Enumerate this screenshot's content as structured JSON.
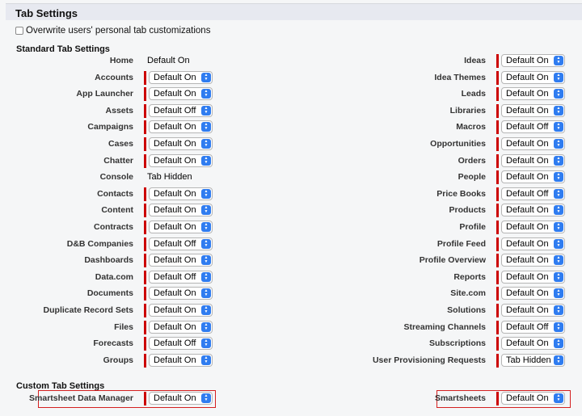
{
  "header": {
    "title": "Tab Settings"
  },
  "overwrite_label": "Overwrite users' personal tab customizations",
  "standard_header": "Standard Tab Settings",
  "custom_header": "Custom Tab Settings",
  "left_rows": [
    {
      "label": "Home",
      "value": "Default On",
      "static": true
    },
    {
      "label": "Accounts",
      "value": "Default On"
    },
    {
      "label": "App Launcher",
      "value": "Default On"
    },
    {
      "label": "Assets",
      "value": "Default Off"
    },
    {
      "label": "Campaigns",
      "value": "Default On"
    },
    {
      "label": "Cases",
      "value": "Default On"
    },
    {
      "label": "Chatter",
      "value": "Default On"
    },
    {
      "label": "Console",
      "value": "Tab Hidden",
      "static": true
    },
    {
      "label": "Contacts",
      "value": "Default On"
    },
    {
      "label": "Content",
      "value": "Default On"
    },
    {
      "label": "Contracts",
      "value": "Default On"
    },
    {
      "label": "D&B Companies",
      "value": "Default Off"
    },
    {
      "label": "Dashboards",
      "value": "Default On"
    },
    {
      "label": "Data.com",
      "value": "Default Off"
    },
    {
      "label": "Documents",
      "value": "Default On"
    },
    {
      "label": "Duplicate Record Sets",
      "value": "Default On"
    },
    {
      "label": "Files",
      "value": "Default On"
    },
    {
      "label": "Forecasts",
      "value": "Default Off"
    },
    {
      "label": "Groups",
      "value": "Default On"
    }
  ],
  "right_rows": [
    {
      "label": "Ideas",
      "value": "Default On"
    },
    {
      "label": "Idea Themes",
      "value": "Default On"
    },
    {
      "label": "Leads",
      "value": "Default On"
    },
    {
      "label": "Libraries",
      "value": "Default On"
    },
    {
      "label": "Macros",
      "value": "Default Off"
    },
    {
      "label": "Opportunities",
      "value": "Default On"
    },
    {
      "label": "Orders",
      "value": "Default On"
    },
    {
      "label": "People",
      "value": "Default On"
    },
    {
      "label": "Price Books",
      "value": "Default Off"
    },
    {
      "label": "Products",
      "value": "Default On"
    },
    {
      "label": "Profile",
      "value": "Default On"
    },
    {
      "label": "Profile Feed",
      "value": "Default On"
    },
    {
      "label": "Profile Overview",
      "value": "Default On"
    },
    {
      "label": "Reports",
      "value": "Default On"
    },
    {
      "label": "Site.com",
      "value": "Default On"
    },
    {
      "label": "Solutions",
      "value": "Default On"
    },
    {
      "label": "Streaming Channels",
      "value": "Default Off"
    },
    {
      "label": "Subscriptions",
      "value": "Default On"
    },
    {
      "label": "User Provisioning Requests",
      "value": "Tab Hidden"
    }
  ],
  "custom_left": {
    "label": "Smartsheet Data Manager",
    "value": "Default On"
  },
  "custom_right": {
    "label": "Smartsheets",
    "value": "Default On"
  },
  "colors": {
    "required": "#cc0000",
    "stepper": "#2f7cf0",
    "highlight": "#d42020"
  }
}
